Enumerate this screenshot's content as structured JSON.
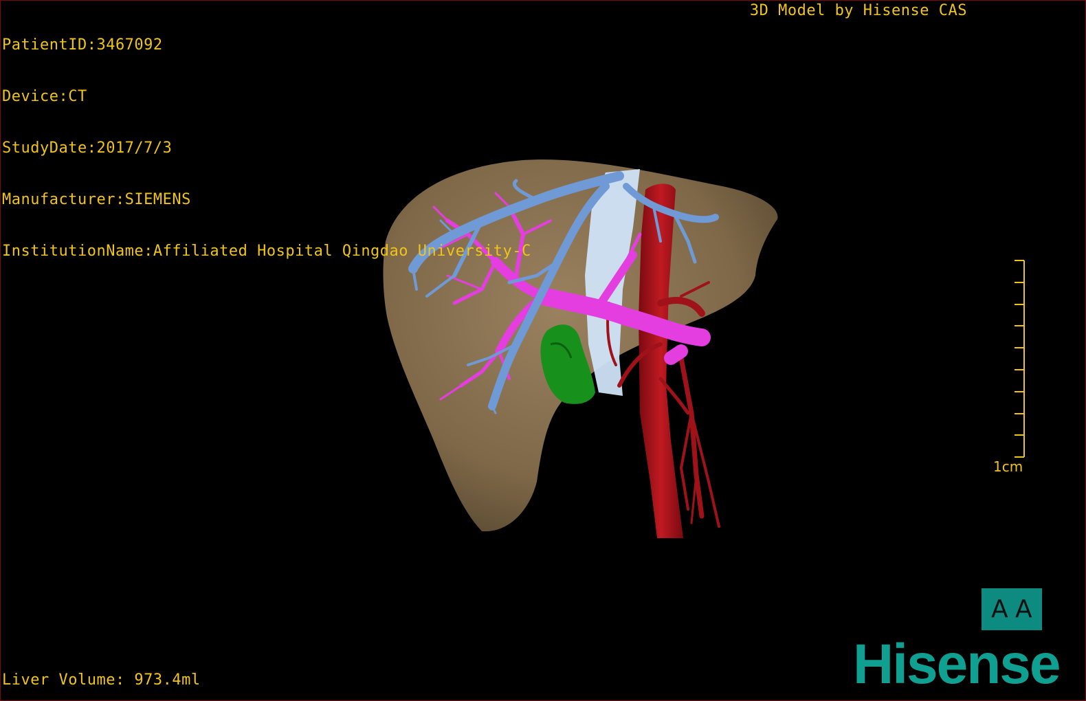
{
  "header": {
    "patient_id": "PatientID:3467092",
    "device": "Device:CT",
    "study_date": "StudyDate:2017/7/3",
    "manufacturer": "Manufacturer:SIEMENS",
    "institution": "InstitutionName:Affiliated Hospital Qingdao University-C",
    "model_title": "3D Model by Hisense CAS"
  },
  "footer": {
    "liver_volume": "Liver Volume: 973.4ml"
  },
  "scale": {
    "label": "1cm"
  },
  "orientation": {
    "left_glyph": "A",
    "right_glyph": "A"
  },
  "brand": {
    "name": "Hisense"
  },
  "colors": {
    "overlay_text": "#f0c419",
    "liver": "#8a7250",
    "hepatic_vein": "#6f9ad6",
    "portal_vein": "#e43ee0",
    "artery": "#b0141c",
    "gallbladder": "#17901c",
    "ivc": "#cfe3f7",
    "brand": "#10a091"
  }
}
